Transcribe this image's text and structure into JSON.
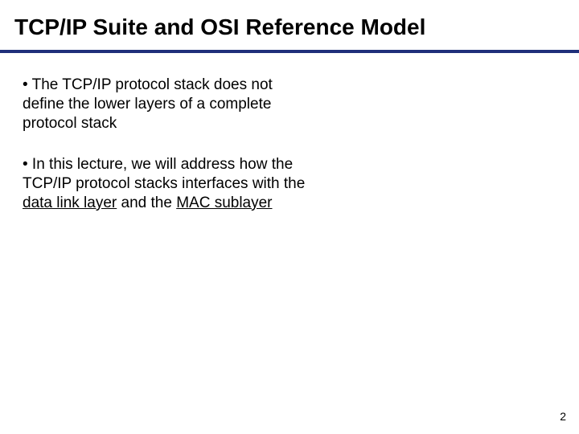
{
  "title": "TCP/IP Suite and OSI Reference Model",
  "bullets": {
    "b1": "• The TCP/IP protocol stack does not define the lower layers of a complete protocol stack",
    "b2_prefix": "• In this lecture, we will address how the TCP/IP protocol stacks interfaces with the ",
    "b2_underline1": "data link layer",
    "b2_mid": " and the ",
    "b2_underline2": "MAC sublayer"
  },
  "page_number": "2"
}
